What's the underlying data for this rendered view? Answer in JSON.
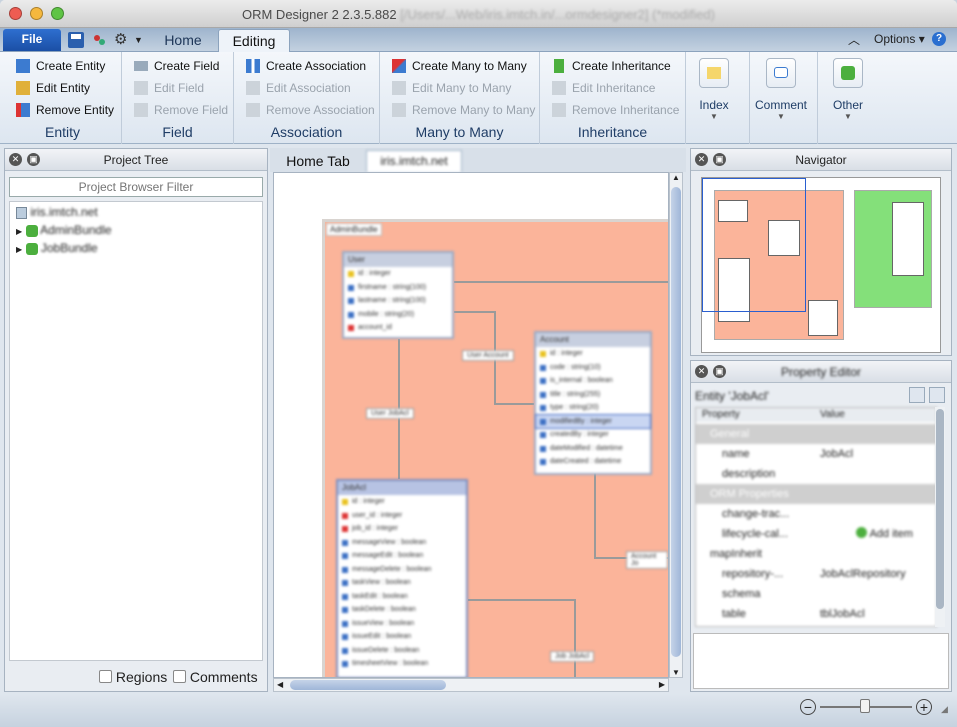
{
  "window": {
    "title": "ORM Designer 2 2.3.5.882",
    "path": "[/Users/...Web/iris.imtch.in/...ormdesigner2] (*modified)"
  },
  "colors": {
    "accent": "#1b4fa5",
    "region_main": "#fbb49a",
    "region_other": "#84e07a",
    "canvas_bg": "#ffffff"
  },
  "menu": {
    "file": "File",
    "tabs": [
      "Home",
      "Editing"
    ],
    "active_tab": "Editing",
    "options": "Options"
  },
  "ribbon": {
    "entity": {
      "title": "Entity",
      "items": [
        "Create Entity",
        "Edit Entity",
        "Remove Entity"
      ]
    },
    "field": {
      "title": "Field",
      "items": [
        "Create Field",
        "Edit Field",
        "Remove Field"
      ]
    },
    "association": {
      "title": "Association",
      "items": [
        "Create Association",
        "Edit Association",
        "Remove Association"
      ]
    },
    "many": {
      "title": "Many to Many",
      "items": [
        "Create Many to Many",
        "Edit Many to Many",
        "Remove Many to Many"
      ]
    },
    "inheritance": {
      "title": "Inheritance",
      "items": [
        "Create Inheritance",
        "Edit Inheritance",
        "Remove Inheritance"
      ]
    },
    "index": "Index",
    "comment": "Comment",
    "other": "Other"
  },
  "project_tree": {
    "title": "Project Tree",
    "filter_placeholder": "Project Browser Filter",
    "root": "iris.imtch.net",
    "children": [
      "AdminBundle",
      "JobBundle"
    ],
    "regions": "Regions",
    "comments": "Comments"
  },
  "doc_tabs": {
    "home": "Home Tab",
    "file": "iris.imtch.net"
  },
  "canvas": {
    "region_label": "AdminBundle",
    "user_entity": {
      "name": "User",
      "fields": [
        "id : integer",
        "firstname : string(100)",
        "lastname : string(100)",
        "mobile : string(20)",
        "account_id"
      ]
    },
    "account_entity": {
      "name": "Account",
      "fields": [
        "id : integer",
        "code : string(10)",
        "is_internal : boolean",
        "title : string(255)",
        "type : string(20)",
        "modifiedBy : integer",
        "createdBy : integer",
        "dateModified : datetime",
        "dateCreated : datetime"
      ]
    },
    "jobacl_entity": {
      "name": "JobAcl",
      "fields": [
        "id : integer",
        "user_id : integer",
        "job_id : integer",
        "messageView : boolean",
        "messageEdit : boolean",
        "messageDelete : boolean",
        "taskView : boolean",
        "taskEdit : boolean",
        "taskDelete : boolean",
        "issueView : boolean",
        "issueEdit : boolean",
        "issueDelete : boolean",
        "timesheetView : boolean"
      ]
    },
    "assoc_labels": [
      "User Account",
      "User JobAcl",
      "Account Jo",
      "Job JobAcl"
    ]
  },
  "navigator": {
    "title": "Navigator"
  },
  "property_editor": {
    "title": "Property Editor",
    "entity": "Entity 'JobAcl'",
    "col_property": "Property",
    "col_value": "Value",
    "sections": [
      "General",
      "ORM Properties"
    ],
    "rows": [
      {
        "p": "name",
        "v": "JobAcl"
      },
      {
        "p": "description",
        "v": ""
      },
      {
        "p": "change-trac...",
        "v": ""
      },
      {
        "p": "lifecycle-cal...",
        "v": "Add item"
      },
      {
        "p": "mapInherit",
        "v": ""
      },
      {
        "p": "repository-...",
        "v": "JobAclRepository"
      },
      {
        "p": "schema",
        "v": ""
      },
      {
        "p": "table",
        "v": "tblJobAcl"
      }
    ]
  }
}
